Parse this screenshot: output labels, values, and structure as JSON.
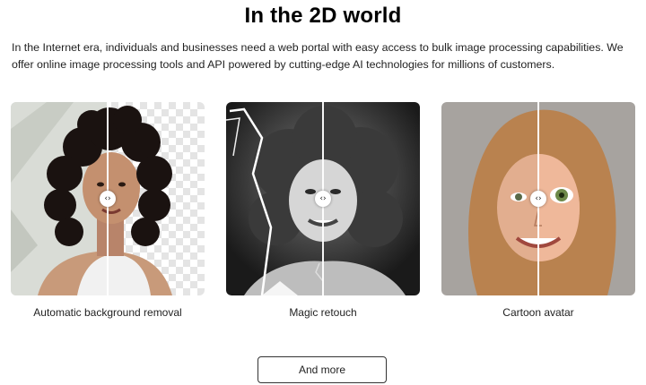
{
  "section": {
    "title": "In the 2D world",
    "intro": "In the Internet era, individuals and businesses need a web portal with easy access to bulk image processing capabilities. We offer online image processing tools and API powered by cutting-edge AI technologies for millions of customers."
  },
  "cards": [
    {
      "caption": "Automatic background removal",
      "handle_icon": "compare-arrows-icon",
      "handle_glyph": "‹›"
    },
    {
      "caption": "Magic retouch",
      "handle_icon": "compare-arrows-icon",
      "handle_glyph": "‹›"
    },
    {
      "caption": "Cartoon avatar",
      "handle_icon": "compare-arrows-icon",
      "handle_glyph": "‹›"
    }
  ],
  "cta": {
    "label": "And more"
  }
}
